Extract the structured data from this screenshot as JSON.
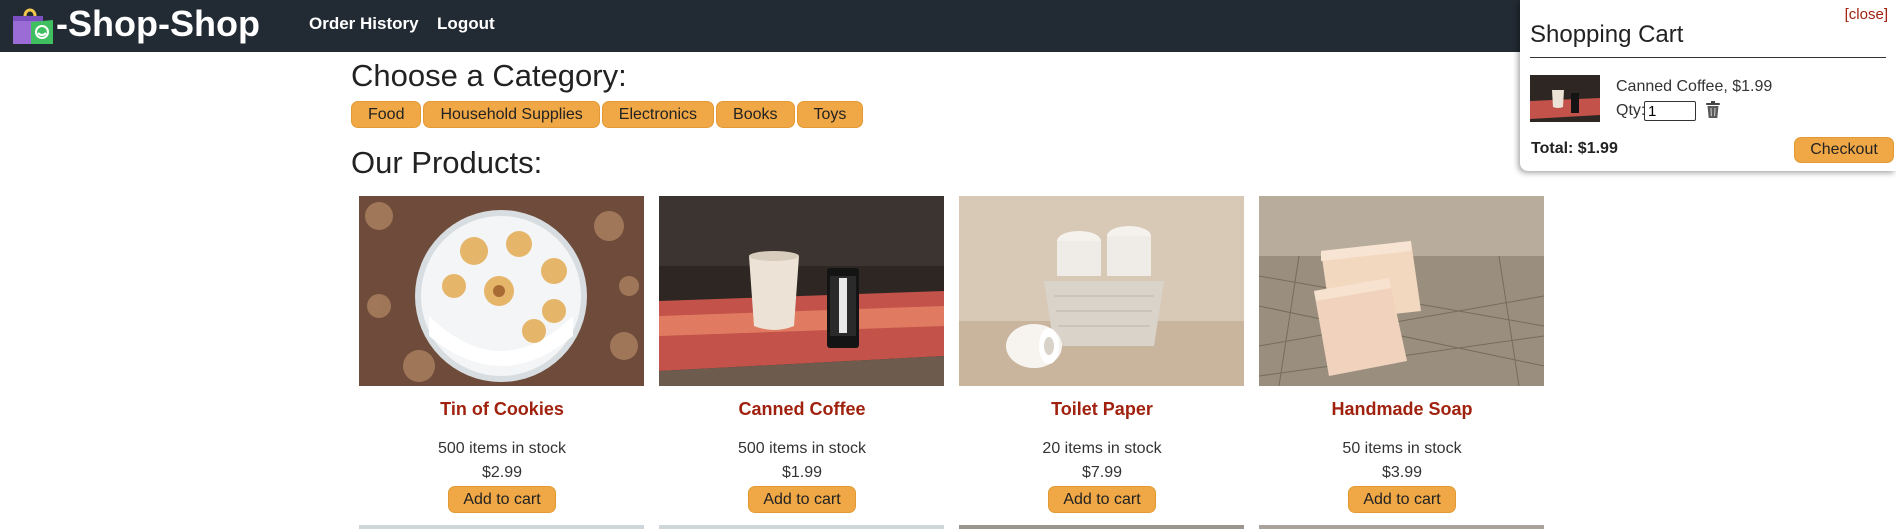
{
  "header": {
    "brand": "-Shop-Shop",
    "logo_icon": "shopping-bag-icon",
    "nav": [
      "Order History",
      "Logout"
    ]
  },
  "categories": {
    "title": "Choose a Category:",
    "items": [
      "Food",
      "Household Supplies",
      "Electronics",
      "Books",
      "Toys"
    ]
  },
  "products": {
    "title": "Our Products:",
    "items": [
      {
        "name": "Tin of Cookies",
        "stock": "500 items in stock",
        "price": "$2.99",
        "button": "Add to cart"
      },
      {
        "name": "Canned Coffee",
        "stock": "500 items in stock",
        "price": "$1.99",
        "button": "Add to cart"
      },
      {
        "name": "Toilet Paper",
        "stock": "20 items in stock",
        "price": "$7.99",
        "button": "Add to cart"
      },
      {
        "name": "Handmade Soap",
        "stock": "50 items in stock",
        "price": "$3.99",
        "button": "Add to cart"
      }
    ]
  },
  "cart": {
    "close": "[close]",
    "title": "Shopping Cart",
    "item": {
      "label": "Canned Coffee, $1.99",
      "qty_label": "Qty:",
      "qty_value": "1"
    },
    "trash_icon": "trash-icon",
    "total": "Total: $1.99",
    "checkout": "Checkout"
  },
  "colors": {
    "header_bg": "#222a33",
    "accent": "#f0a846",
    "product_name": "#a0220e"
  }
}
